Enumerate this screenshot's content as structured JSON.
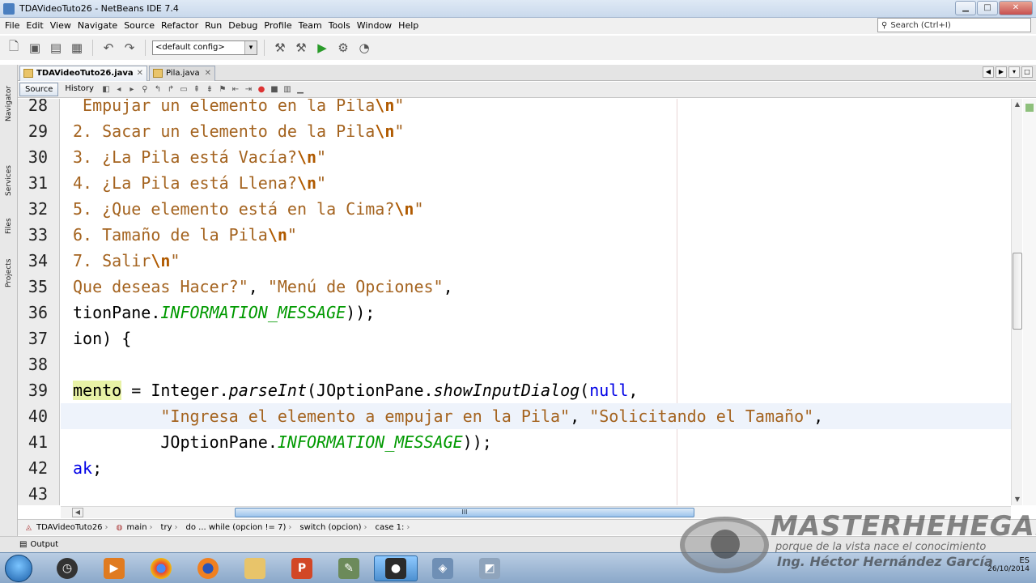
{
  "window": {
    "title": "TDAVideoTuto26 - NetBeans IDE 7.4",
    "minimize": "▁",
    "maximize": "□",
    "close": "✕"
  },
  "menu": [
    "File",
    "Edit",
    "View",
    "Navigate",
    "Source",
    "Refactor",
    "Run",
    "Debug",
    "Profile",
    "Team",
    "Tools",
    "Window",
    "Help"
  ],
  "search": {
    "placeholder": "Search (Ctrl+I)"
  },
  "toolbar": {
    "config": "<default config>"
  },
  "side_tabs": [
    "Navigator",
    "Services",
    "Files",
    "Projects"
  ],
  "editor_tabs": [
    {
      "label": "TDAVideoTuto26.java",
      "active": true
    },
    {
      "label": "Pila.java",
      "active": false
    }
  ],
  "editor_toolbar": {
    "source": "Source",
    "history": "History"
  },
  "lines": [
    {
      "no": "28",
      "html": " <span class=\"str\">Empujar un elemento en la Pila</span><span class=\"esc\">\\n</span><span class=\"str\">\"</span>"
    },
    {
      "no": "29",
      "html": "<span class=\"str\">2. Sacar un elemento de la Pila</span><span class=\"esc\">\\n</span><span class=\"str\">\"</span>"
    },
    {
      "no": "30",
      "html": "<span class=\"str\">3. ¿La Pila está Vacía?</span><span class=\"esc\">\\n</span><span class=\"str\">\"</span>"
    },
    {
      "no": "31",
      "html": "<span class=\"str\">4. ¿La Pila está Llena?</span><span class=\"esc\">\\n</span><span class=\"str\">\"</span>"
    },
    {
      "no": "32",
      "html": "<span class=\"str\">5. ¿Que elemento está en la Cima?</span><span class=\"esc\">\\n</span><span class=\"str\">\"</span>"
    },
    {
      "no": "33",
      "html": "<span class=\"str\">6. Tamaño de la Pila</span><span class=\"esc\">\\n</span><span class=\"str\">\"</span>"
    },
    {
      "no": "34",
      "html": "<span class=\"str\">7. Salir</span><span class=\"esc\">\\n</span><span class=\"str\">\"</span>"
    },
    {
      "no": "35",
      "html": "<span class=\"str\">Que deseas Hacer?\"</span>, <span class=\"str\">\"Menú de Opciones\"</span>,"
    },
    {
      "no": "36",
      "html": "tionPane.<span class=\"const\">INFORMATION_MESSAGE</span>));"
    },
    {
      "no": "37",
      "html": "ion) {"
    },
    {
      "no": "38",
      "html": ""
    },
    {
      "no": "39",
      "html": "<span class=\"hl\">mento</span> = Integer.<span class=\"ital\">parseInt</span>(JOptionPane.<span class=\"ital\">showInputDialog</span>(<span class=\"kw\">null</span>,"
    },
    {
      "no": "40",
      "html": "         <span class=\"str\">\"Ingresa el elemento a empujar en la Pila\"</span>, <span class=\"str\">\"Solicitando el Tamaño\"</span>,",
      "current": true
    },
    {
      "no": "41",
      "html": "         JOptionPane.<span class=\"const\">INFORMATION_MESSAGE</span>));"
    },
    {
      "no": "42",
      "html": "<span class=\"kw\">ak</span>;"
    },
    {
      "no": "43",
      "html": ""
    }
  ],
  "hscroll_label": "III",
  "breadcrumb": [
    "TDAVideoTuto26",
    "main",
    "try",
    "do ... while (opcion != 7)",
    "switch (opcion)",
    "case 1:"
  ],
  "output": {
    "label": "Output"
  },
  "taskbar": {
    "apps": [
      "clock",
      "media",
      "chrome",
      "firefox",
      "explorer",
      "powerpoint",
      "notepad",
      "camtasia",
      "virtualbox",
      "netbeans"
    ],
    "date": "26/10/2014",
    "lang": "ES"
  },
  "watermark": {
    "brand": "MASTERHEHEGAR",
    "tagline": "porque de la vista nace el conocimiento",
    "author": "Ing. Héctor Hernández García"
  }
}
